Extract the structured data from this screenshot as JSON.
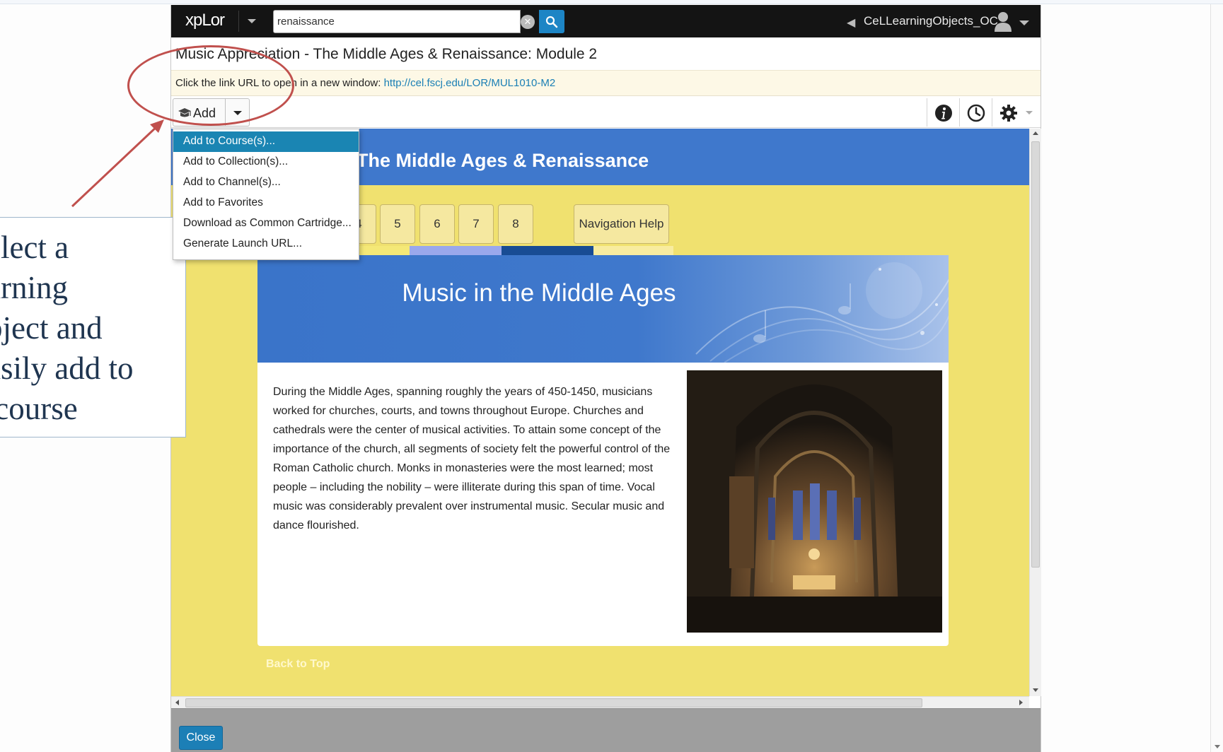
{
  "topbar": {
    "logo": "xpLor",
    "search_value": "renaissance",
    "username": "CeLLearningObjects_OC"
  },
  "page": {
    "title": "Music Appreciation - The Middle Ages & Renaissance: Module 2",
    "info_prefix": "Click the link URL to open in a new window:",
    "info_link": "http://cel.fscj.edu/LOR/MUL1010-M2"
  },
  "toolbar": {
    "add_label": "Add",
    "icons": [
      "info-icon",
      "clock-icon",
      "gear-icon"
    ]
  },
  "menu": {
    "items": [
      "Add to Course(s)...",
      "Add to Collection(s)...",
      "Add to Channel(s)...",
      "Add to Favorites",
      "Download as Common Cartridge...",
      "Generate Launch URL..."
    ],
    "active_index": 0
  },
  "content": {
    "banner_title": "The Middle Ages & Renaissance",
    "nav_buttons": [
      "4",
      "5",
      "6",
      "7",
      "8"
    ],
    "nav_help": "Navigation Help",
    "hero_title": "Music in the Middle Ages",
    "body_text": "During the Middle Ages, spanning roughly the years of 450-1450, musicians worked for churches, courts, and towns throughout Europe. Churches and cathedrals were the center of musical activities. To attain some concept of the importance of the church, all segments of society felt the powerful control of the Roman Catholic church. Monks in monasteries were the most learned; most people – including the nobility – were illiterate during this span of time. Vocal music was considerably prevalent over instrumental music. Secular music and dance flourished.",
    "back_to_top": "Back to Top"
  },
  "footer": {
    "close_label": "Close"
  },
  "annotation": {
    "lines": [
      "elect a",
      "arning",
      "bject and",
      "asily add to",
      " course"
    ]
  },
  "colors": {
    "accent_blue": "#1d85c5",
    "banner_blue": "#3f78cc",
    "content_yellow": "#f0e16f",
    "annotation_red": "#c0504d",
    "annotation_text": "#1f3550"
  }
}
